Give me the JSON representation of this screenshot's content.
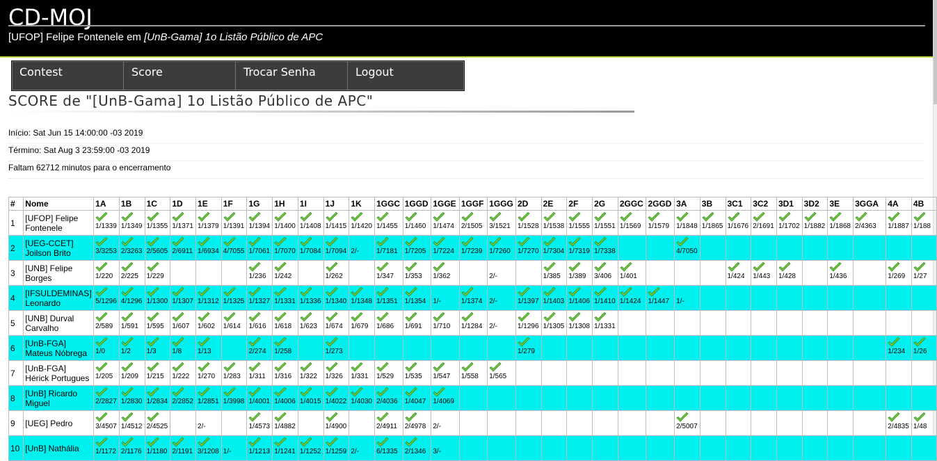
{
  "header": {
    "app_title": "CD-MOJ",
    "user": "[UFOP] Felipe Fontenele",
    "em": "em",
    "contest_name": "[UnB-Gama] 1o Listão Público de APC"
  },
  "nav": {
    "items": [
      "Contest",
      "Score",
      "Trocar Senha",
      "Logout"
    ]
  },
  "page": {
    "title": "SCORE de \"[UnB-Gama] 1o Listão Público de APC\"",
    "start": "Início: Sat Jun 15 14:00:00 -03 2019",
    "end": "Término: Sat Aug 3 23:59:00 -03 2019",
    "remaining": "Faltam 62712 minutos para o encerramento"
  },
  "colors": {
    "even_row": "#00efef",
    "check_green": "#6fcf3f"
  },
  "icons": {
    "accepted": "check-icon"
  },
  "table": {
    "headers": [
      "#",
      "Nome",
      "1A",
      "1B",
      "1C",
      "1D",
      "1E",
      "1F",
      "1G",
      "1H",
      "1I",
      "1J",
      "1K",
      "1GGC",
      "1GGD",
      "1GGE",
      "1GGF",
      "1GGG",
      "2D",
      "2E",
      "2F",
      "2G",
      "2GGC",
      "2GGD",
      "3A",
      "3B",
      "3C1",
      "3C2",
      "3D1",
      "3D2",
      "3E",
      "3GGA",
      "4A",
      "4B"
    ],
    "rows": [
      {
        "num": "1",
        "name": "[UFOP] Felipe Fontenele",
        "cells": [
          "1/1339",
          "1/1349",
          "1/1355",
          "1/1371",
          "1/1379",
          "1/1391",
          "1/1394",
          "1/1400",
          "1/1408",
          "1/1415",
          "1/1420",
          "1/1455",
          "1/1460",
          "1/1474",
          "2/1505",
          "3/1521",
          "1/1528",
          "1/1538",
          "1/1555",
          "1/1551",
          "1/1569",
          "1/1579",
          "1/1848",
          "1/1865",
          "1/1676",
          "2/1691",
          "1/1702",
          "1/1882",
          "1/1868",
          "2/4363",
          "1/1887",
          "1/188"
        ]
      },
      {
        "num": "2",
        "name": "[UEG-CCET] Joilson Brito",
        "cells": [
          "3/3253",
          "2/3263",
          "2/5605",
          "2/6911",
          "1/6934",
          "4/7055",
          "1/7061",
          "1/7070",
          "1/7084",
          "1/7094",
          "2/-",
          "1/7181",
          "1/7205",
          "1/7224",
          "1/7239",
          "1/7260",
          "1/7270",
          "1/7304",
          "1/7319",
          "1/7338",
          "",
          "",
          "4/7050",
          "",
          "",
          "",
          "",
          "",
          "",
          "",
          "",
          ""
        ]
      },
      {
        "num": "3",
        "name": "[UNB] Felipe Borges",
        "cells": [
          "1/220",
          "2/225",
          "1/229",
          "",
          "",
          "",
          "1/236",
          "1/242",
          "",
          "1/262",
          "",
          "1/347",
          "1/353",
          "1/362",
          "",
          "2/-",
          "",
          "1/385",
          "1/389",
          "3/406",
          "1/401",
          "",
          "",
          "",
          "1/424",
          "1/443",
          "1/428",
          "",
          "1/436",
          "",
          "1/269",
          "1/27"
        ]
      },
      {
        "num": "4",
        "name": "[IFSULDEMINAS] Leonardo",
        "cells": [
          "5/1296",
          "4/1296",
          "1/1300",
          "1/1307",
          "1/1312",
          "1/1325",
          "1/1327",
          "1/1331",
          "1/1336",
          "1/1340",
          "1/1348",
          "1/1351",
          "1/1354",
          "1/-",
          "1/1374",
          "2/-",
          "1/1397",
          "1/1403",
          "1/1406",
          "1/1410",
          "1/1424",
          "1/1447",
          "1/-",
          "",
          "",
          "",
          "",
          "",
          "",
          "",
          "",
          ""
        ]
      },
      {
        "num": "5",
        "name": "[UNB] Durval Carvalho",
        "cells": [
          "2/589",
          "1/591",
          "1/595",
          "1/607",
          "1/602",
          "1/614",
          "1/616",
          "1/618",
          "1/623",
          "1/674",
          "1/679",
          "1/686",
          "1/691",
          "1/710",
          "1/1284",
          "2/-",
          "1/1296",
          "1/1305",
          "1/1308",
          "1/1331",
          "",
          "",
          "",
          "",
          "",
          "",
          "",
          "",
          "",
          "",
          "",
          ""
        ]
      },
      {
        "num": "6",
        "name": "[UnB-FGA] Mateus Nóbrega",
        "cells": [
          "1/0",
          "1/2",
          "1/3",
          "1/8",
          "1/13",
          "",
          "2/274",
          "1/258",
          "",
          "1/273",
          "",
          "",
          "",
          "",
          "",
          "",
          "1/279",
          "",
          "",
          "",
          "",
          "",
          "",
          "",
          "",
          "",
          "",
          "",
          "",
          "",
          "1/234",
          "1/26"
        ]
      },
      {
        "num": "7",
        "name": "[UnB-FGA] Hérick Portugues",
        "cells": [
          "1/205",
          "1/209",
          "1/215",
          "1/222",
          "1/270",
          "1/283",
          "1/311",
          "1/316",
          "1/322",
          "1/326",
          "1/331",
          "1/529",
          "1/535",
          "1/547",
          "1/558",
          "1/565",
          "",
          "",
          "",
          "",
          "",
          "",
          "",
          "",
          "",
          "",
          "",
          "",
          "",
          "",
          "",
          ""
        ]
      },
      {
        "num": "8",
        "name": "[UnB] Ricardo Miguel",
        "cells": [
          "2/2827",
          "1/2830",
          "1/2834",
          "2/2852",
          "1/2851",
          "1/3998",
          "1/4001",
          "1/4006",
          "1/4015",
          "1/4022",
          "1/4030",
          "2/4036",
          "1/4047",
          "1/4069",
          "",
          "",
          "",
          "",
          "",
          "",
          "",
          "",
          "",
          "",
          "",
          "",
          "",
          "",
          "",
          "",
          "",
          ""
        ]
      },
      {
        "num": "9",
        "name": "[UEG] Pedro",
        "cells": [
          "3/4507",
          "1/4512",
          "2/4525",
          "",
          "2/-",
          "",
          "1/4573",
          "1/4882",
          "",
          "1/4900",
          "",
          "2/4911",
          "2/4978",
          "2/-",
          "",
          "",
          "",
          "",
          "",
          "",
          "",
          "",
          "2/5007",
          "",
          "",
          "",
          "",
          "",
          "",
          "",
          "2/4835",
          "1/48"
        ]
      },
      {
        "num": "10",
        "name": "[UnB] Nathália",
        "cells": [
          "1/1172",
          "2/1176",
          "1/1180",
          "2/1191",
          "3/1208",
          "1/-",
          "1/1213",
          "1/1241",
          "1/1252",
          "1/1259",
          "2/-",
          "6/1335",
          "2/1346",
          "3/-",
          "",
          "",
          "",
          "",
          "",
          "",
          "",
          "",
          "",
          "",
          "",
          "",
          "",
          "",
          "",
          "",
          "",
          ""
        ]
      }
    ]
  }
}
